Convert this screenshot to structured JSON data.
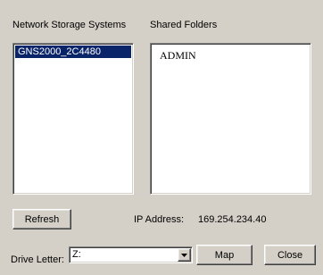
{
  "storage": {
    "label": "Network Storage Systems",
    "items": [
      {
        "name": "GNS2000_2C4480",
        "selected": true
      }
    ]
  },
  "folders": {
    "label": "Shared Folders",
    "items": [
      {
        "name": "ADMIN"
      }
    ]
  },
  "refresh_label": "Refresh",
  "ip": {
    "label": "IP Address:",
    "value": "169.254.234.40"
  },
  "drive": {
    "label": "Drive Letter:",
    "value": "Z:"
  },
  "map_label": "Map",
  "close_label": "Close",
  "icons": {
    "dropdown": "chevron-down-icon"
  },
  "colors": {
    "face": "#d4d0c8",
    "selection": "#0a246a"
  }
}
